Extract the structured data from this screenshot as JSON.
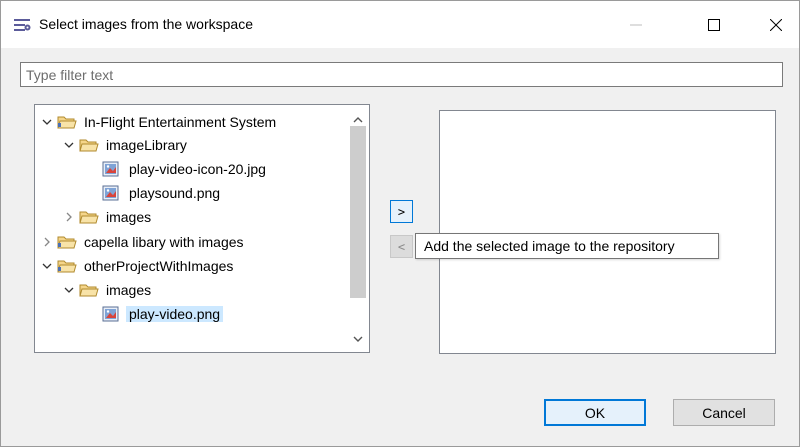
{
  "window": {
    "title": "Select images from the workspace",
    "icon": "image-list-icon",
    "controls": [
      "minimize",
      "maximize",
      "close"
    ]
  },
  "filter": {
    "placeholder": "Type filter text",
    "value": ""
  },
  "tree": {
    "items": [
      {
        "label": "In-Flight Entertainment System",
        "type": "project",
        "expanded": true,
        "selected": false
      },
      {
        "label": "imageLibrary",
        "type": "folder",
        "expanded": true,
        "selected": false
      },
      {
        "label": "play-video-icon-20.jpg",
        "type": "image-file",
        "selected": false
      },
      {
        "label": "playsound.png",
        "type": "image-file",
        "selected": false
      },
      {
        "label": "images",
        "type": "folder",
        "expanded": false,
        "selected": false
      },
      {
        "label": "capella libary with images",
        "type": "project",
        "expanded": false,
        "selected": false
      },
      {
        "label": "otherProjectWithImages",
        "type": "project",
        "expanded": true,
        "selected": false
      },
      {
        "label": "images",
        "type": "folder",
        "expanded": true,
        "selected": false
      },
      {
        "label": "play-video.png",
        "type": "image-file",
        "selected": true
      }
    ]
  },
  "transfer": {
    "add_label": ">",
    "remove_label": "<",
    "tooltip": "Add the selected image to the repository"
  },
  "buttons": {
    "ok": "OK",
    "cancel": "Cancel"
  },
  "colors": {
    "selection": "#cce8ff",
    "focus_border": "#0078d7",
    "folder": "#e8b84a"
  }
}
